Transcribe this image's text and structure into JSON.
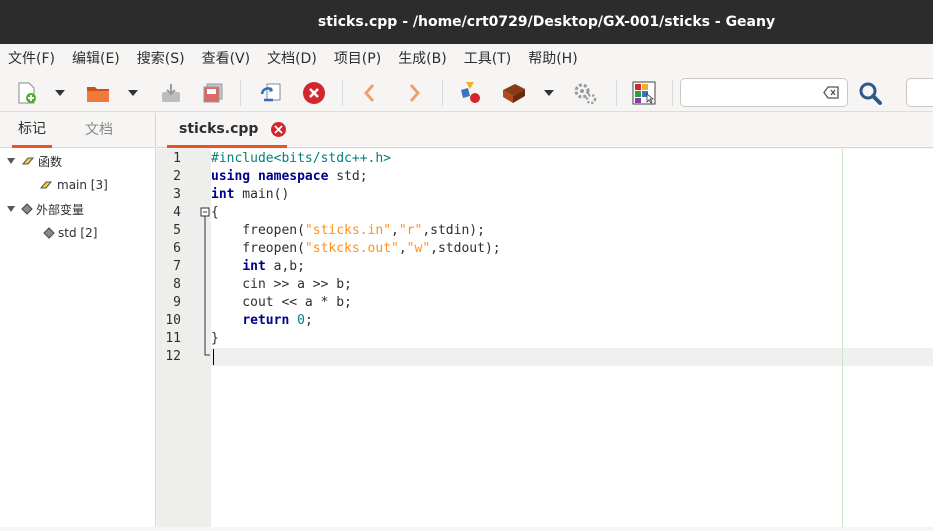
{
  "window": {
    "title": "sticks.cpp - /home/crt0729/Desktop/GX-001/sticks - Geany"
  },
  "menubar": {
    "items": [
      "文件(F)",
      "编辑(E)",
      "搜索(S)",
      "查看(V)",
      "文档(D)",
      "项目(P)",
      "生成(B)",
      "工具(T)",
      "帮助(H)"
    ]
  },
  "toolbar": {
    "buttons": [
      "new-file",
      "open-file",
      "save-file",
      "save-all",
      "reload",
      "close-file",
      "navigate-back",
      "navigate-forward",
      "compile",
      "build",
      "execute-settings",
      "color-chooser",
      "search"
    ],
    "search_value": "",
    "goto_value": ""
  },
  "sidebar": {
    "tabs": [
      "标记",
      "文档"
    ],
    "tree": [
      {
        "label": "函数",
        "level": 0
      },
      {
        "label": "main [3]",
        "level": 1
      },
      {
        "label": "外部变量",
        "level": 0
      },
      {
        "label": "std [2]",
        "level": 1
      }
    ]
  },
  "editor": {
    "tab_name": "sticks.cpp",
    "line_numbers": [
      "1",
      "2",
      "3",
      "4",
      "5",
      "6",
      "7",
      "8",
      "9",
      "10",
      "11",
      "12"
    ],
    "lines": [
      "#include<bits/stdc++.h>",
      "using namespace std;",
      "int main()",
      "{",
      "    freopen(\"sticks.in\",\"r\",stdin);",
      "    freopen(\"stkcks.out\",\"w\",stdout);",
      "    int a,b;",
      "    cin >> a >> b;",
      "    cout << a * b;",
      "    return 0;",
      "}",
      ""
    ],
    "current_line": 12
  },
  "colors": {
    "accent": "#e95420",
    "keyword": "#00008b",
    "preprocessor": "#007f7f",
    "string": "#ff901e",
    "number": "#008080"
  }
}
